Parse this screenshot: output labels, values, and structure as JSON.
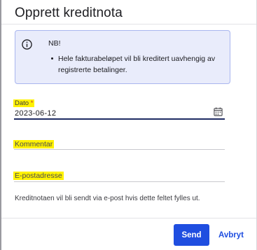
{
  "dialog": {
    "title": "Opprett kreditnota"
  },
  "notice": {
    "icon": "info-icon",
    "title": "NB!",
    "items": [
      "Hele fakturabeløpet vil bli kreditert uavhengig av registrerte betalinger."
    ]
  },
  "fields": {
    "date": {
      "label": "Dato",
      "required_marker": "*",
      "value": "2023-06-12",
      "icon": "calendar-icon"
    },
    "comment": {
      "placeholder": "Kommentar",
      "value": ""
    },
    "email": {
      "placeholder": "E-postadresse",
      "value": "",
      "helper": "Kreditnotaen vil bli sendt via e-post hvis dette feltet fylles ut."
    }
  },
  "actions": {
    "send_label": "Send",
    "cancel_label": "Avbryt"
  },
  "colors": {
    "accent": "#1f4ee0",
    "notice_bg": "#e9ecfb",
    "notice_border": "#a9b6ef",
    "active_underline": "#1f2c63",
    "highlight": "#fff200",
    "required": "#c23a2b"
  }
}
